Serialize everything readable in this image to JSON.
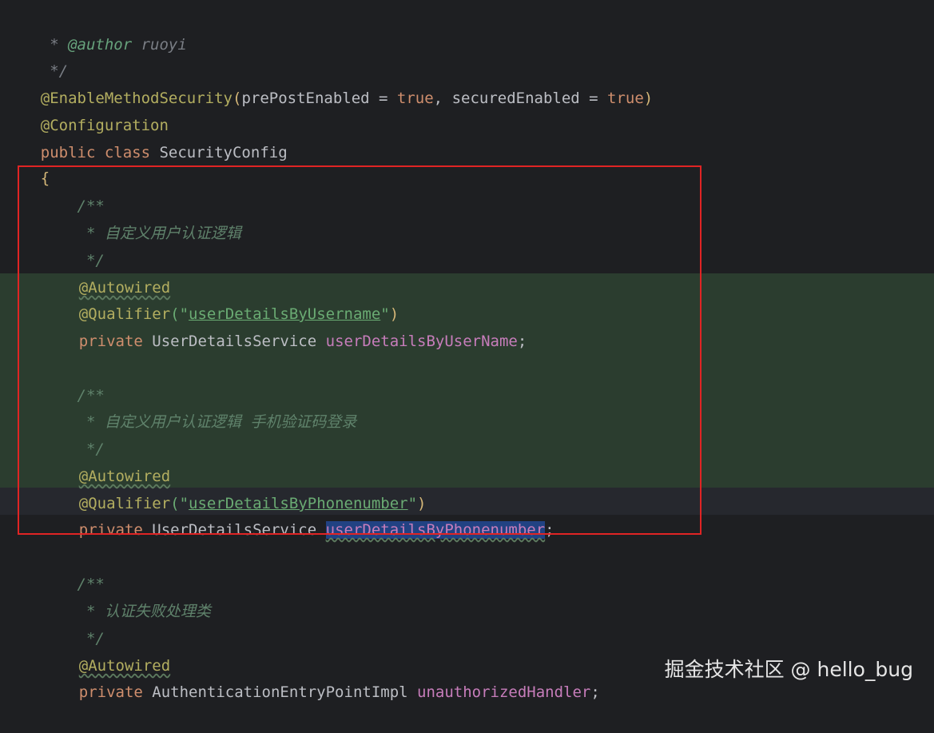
{
  "code": {
    "author_line": {
      "star": " * ",
      "tag": "@author",
      "rest": " ruoyi"
    },
    "end_comment_1": " */",
    "enable_method_security": {
      "annotation": "@EnableMethodSecurity",
      "open": "(",
      "arg1": "prePostEnabled = ",
      "val1": "true",
      "sep": ", ",
      "arg2": "securedEnabled = ",
      "val2": "true",
      "close": ")"
    },
    "configuration": "@Configuration",
    "class_decl": {
      "kw": "public class ",
      "name": "SecurityConfig"
    },
    "open_brace": "{",
    "doc1": {
      "open": "    /**",
      "text": "     * 自定义用户认证逻辑",
      "close": "     */"
    },
    "autowired_1": "@Autowired",
    "qualifier_1": {
      "annotation": "@Qualifier",
      "open": "(\"",
      "value": "userDetailsByUsername",
      "close_q": "\"",
      "close": ")"
    },
    "field_1": {
      "kw": "private ",
      "type": "UserDetailsService ",
      "name": "userDetailsByUserName",
      "end": ";"
    },
    "doc2": {
      "open": "    /**",
      "text": "     * 自定义用户认证逻辑 手机验证码登录",
      "close": "     */"
    },
    "autowired_2": "@Autowired",
    "qualifier_2": {
      "annotation": "@Qualifier",
      "open": "(\"",
      "value": "userDetailsByPhonenumber",
      "close_q": "\"",
      "close": ")"
    },
    "field_2": {
      "kw": "private ",
      "type": "UserDetailsService ",
      "name": "userDetailsByPhonenumber",
      "end": ";"
    },
    "doc3": {
      "open": "    /**",
      "text": "     * 认证失败处理类",
      "close": "     */"
    },
    "autowired_3": "@Autowired",
    "field_3": {
      "kw": "private ",
      "type": "AuthenticationEntryPointImpl ",
      "name": "unauthorizedHandler",
      "end": ";"
    }
  },
  "watermark": "掘金技术社区 @ hello_bug",
  "colors": {
    "background": "#1e1f22",
    "highlight_green": "#2b3d2f",
    "annotation": "#b3ae60",
    "keyword": "#cf8e6d",
    "string": "#6aab73",
    "field": "#c77dbb",
    "doc_comment": "#5f826b",
    "red_box": "#e02424"
  }
}
